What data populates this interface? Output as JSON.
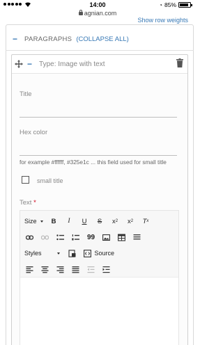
{
  "status_bar": {
    "time": "14:00",
    "battery": "85%"
  },
  "browser": {
    "url": "agnian.com"
  },
  "page": {
    "top_link": "Show row weights",
    "paragraphs_label": "PARAGRAPHS",
    "collapse_all": "(COLLAPSE ALL)"
  },
  "card": {
    "type_label": "Type: Image with text",
    "fields": {
      "title_label": "Title",
      "hex_label": "Hex color",
      "hex_help": "for example #ffffff, #325e1c ... this field used for small title",
      "small_title_label": "small title",
      "text_label": "Text",
      "required_mark": "*"
    }
  },
  "editor": {
    "size_label": "Size",
    "styles_label": "Styles",
    "source_label": "Source",
    "quote_glyph": "99"
  }
}
